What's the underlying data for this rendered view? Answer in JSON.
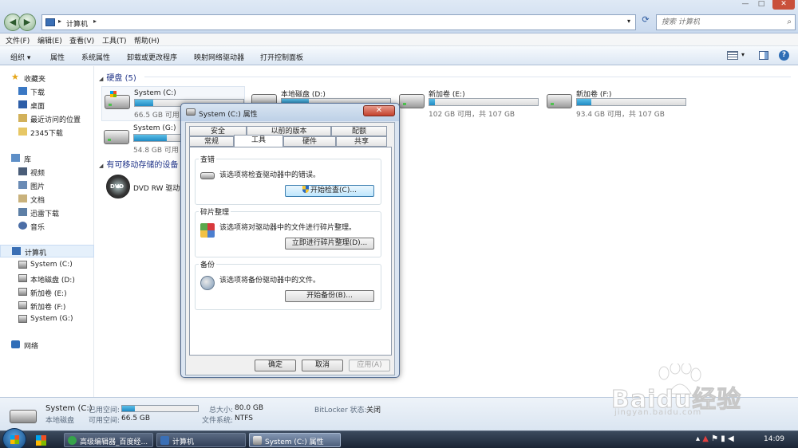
{
  "window": {
    "address_path": "计算机",
    "search_placeholder": "搜索 计算机",
    "controls": {
      "minimize": "—",
      "maximize": "□",
      "close": "✕"
    }
  },
  "menubar": [
    "文件(F)",
    "编辑(E)",
    "查看(V)",
    "工具(T)",
    "帮助(H)"
  ],
  "toolbar": [
    "组织 ▾",
    "属性",
    "系统属性",
    "卸载或更改程序",
    "映射网络驱动器",
    "打开控制面板"
  ],
  "sidebar": {
    "favorites": {
      "title": "收藏夹",
      "items": [
        "下载",
        "桌面",
        "最近访问的位置",
        "2345下载"
      ]
    },
    "libraries": {
      "title": "库",
      "items": [
        "视频",
        "图片",
        "文档",
        "迅雷下载",
        "音乐"
      ]
    },
    "computer": {
      "title": "计算机",
      "items": [
        "System (C:)",
        "本地磁盘 (D:)",
        "新加卷 (E:)",
        "新加卷 (F:)",
        "System (G:)"
      ]
    },
    "network": {
      "title": "网络"
    }
  },
  "content": {
    "hdd_group": "硬盘 (5)",
    "removable_group": "有可移动存储的设备",
    "drives": [
      {
        "name": "System (C:)",
        "free": "66.5 GB 可用",
        "used_fraction": 0.17
      },
      {
        "name": "本地磁盘 (D:)",
        "free": "",
        "used_fraction": 0.25
      },
      {
        "name": "新加卷 (E:)",
        "free": "102 GB 可用，共 107 GB",
        "used_fraction": 0.05
      },
      {
        "name": "新加卷 (F:)",
        "free": "93.4 GB 可用，共 107 GB",
        "used_fraction": 0.13
      },
      {
        "name": "System (G:)",
        "free": "54.8 GB 可用",
        "used_fraction": 0.3
      }
    ],
    "dvd": "DVD RW 驱动"
  },
  "details": {
    "name": "System (C:)",
    "used_label": "已用空间:",
    "used_fraction": 0.17,
    "type": "本地磁盘",
    "free_label": "可用空间:",
    "free_value": "66.5 GB",
    "total_label": "总大小:",
    "total_value": "80.0 GB",
    "fs_label": "文件系统:",
    "fs_value": "NTFS",
    "bitlocker_label": "BitLocker 状态:",
    "bitlocker_value": "关闭"
  },
  "dialog": {
    "title": "System (C:) 属性",
    "close": "✕",
    "tabs_row1": [
      "安全",
      "以前的版本",
      "配额"
    ],
    "tabs_row2": [
      "常规",
      "工具",
      "硬件",
      "共享"
    ],
    "active_tab": "工具",
    "sections": [
      {
        "title": "查错",
        "text": "该选项将检查驱动器中的错误。",
        "button": "开始检查(C)..."
      },
      {
        "title": "碎片整理",
        "text": "该选项将对驱动器中的文件进行碎片整理。",
        "button": "立即进行碎片整理(D)..."
      },
      {
        "title": "备份",
        "text": "该选项将备份驱动器中的文件。",
        "button": "开始备份(B)..."
      }
    ],
    "ok": "确定",
    "cancel": "取消",
    "apply": "应用(A)"
  },
  "taskbar": {
    "tasks": [
      "高级编辑器_百度经...",
      "计算机",
      "System (C:) 属性"
    ],
    "time": "14:09"
  },
  "watermark": {
    "text": "Baidu经验",
    "url": "jingyan.baidu.com"
  },
  "colors": {
    "accent": "#1f8ac4",
    "group_header": "#1e3287",
    "taskbar": "#1b2535"
  },
  "icons": [
    "back-icon",
    "forward-icon",
    "refresh-icon",
    "search-icon",
    "star-icon",
    "folder-icon",
    "computer-icon",
    "network-icon",
    "drive-icon",
    "dvd-icon",
    "shield-icon"
  ]
}
